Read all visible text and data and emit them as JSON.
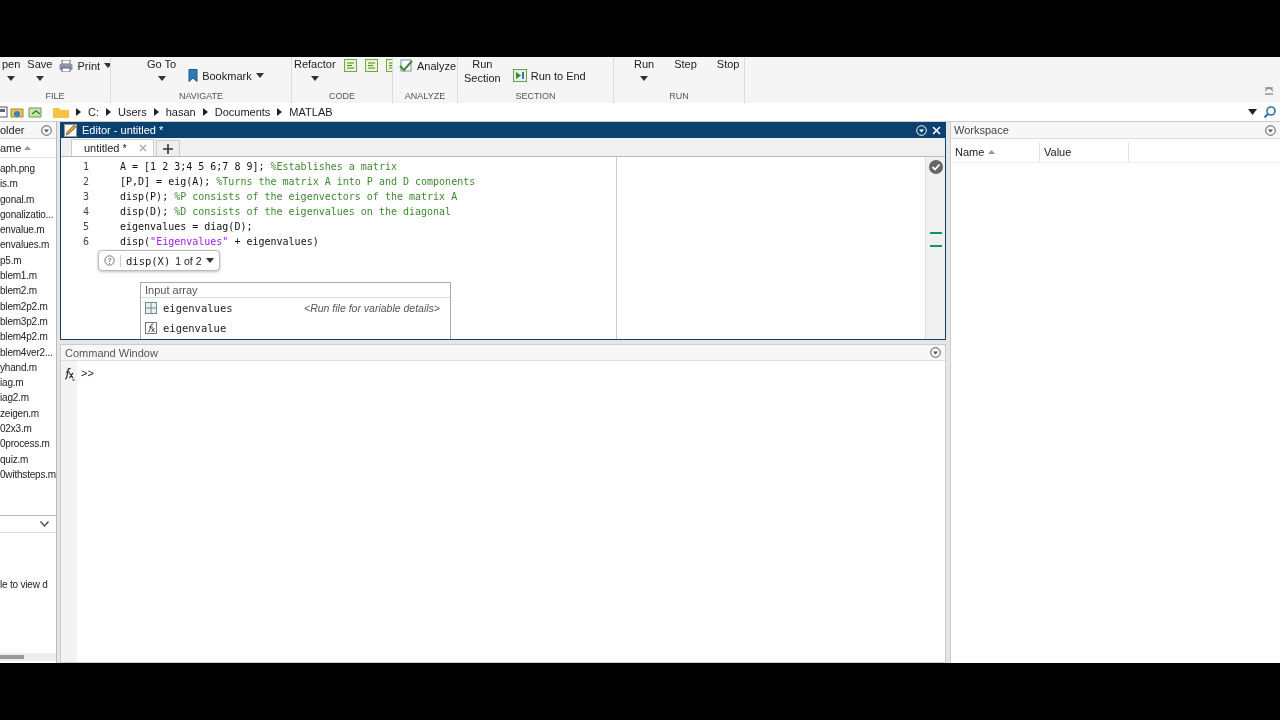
{
  "toolstrip": {
    "groups": [
      {
        "label": "FILE",
        "columns": [
          {
            "kind": "big",
            "label": "pen",
            "caret": true
          },
          {
            "kind": "big",
            "label": "Save",
            "caret": true
          },
          {
            "kind": "small",
            "items": [
              {
                "label": "Print",
                "caret": true
              }
            ]
          }
        ]
      },
      {
        "label": "NAVIGATE",
        "columns": [
          {
            "kind": "big",
            "label": "Go To",
            "caret": true
          },
          {
            "kind": "small",
            "items": [
              {
                "label": "Bookmark",
                "caret": true
              }
            ]
          }
        ]
      },
      {
        "label": "CODE",
        "columns": [
          {
            "kind": "big",
            "label": "Refactor",
            "caret": true
          },
          {
            "kind": "icons",
            "items": [
              {
                "kind": "icon"
              },
              {
                "kind": "icon"
              },
              {
                "kind": "icon"
              }
            ]
          }
        ]
      },
      {
        "label": "ANALYZE",
        "columns": [
          {
            "kind": "small",
            "items": [
              {
                "label": "Analyze"
              }
            ]
          }
        ]
      },
      {
        "label": "SECTION",
        "columns": [
          {
            "kind": "big",
            "label": "Run\nSection",
            "caret": false
          },
          {
            "kind": "small",
            "items": [
              {
                "label": "Run to End"
              }
            ]
          }
        ]
      },
      {
        "label": "RUN",
        "columns": [
          {
            "kind": "big",
            "label": "Run",
            "caret": true
          },
          {
            "kind": "big",
            "label": "Step",
            "caret": false
          },
          {
            "kind": "big",
            "label": "Stop",
            "caret": false
          }
        ]
      }
    ]
  },
  "address_bar": {
    "path": [
      "C:",
      "Users",
      "hasan",
      "Documents",
      "MATLAB"
    ]
  },
  "current_folder": {
    "title": "older",
    "column": "ame",
    "files": [
      "aph.png",
      "is.m",
      "gonal.m",
      "gonalizatio...",
      "envalue.m",
      "envalues.m",
      "p5.m",
      "blem1.m",
      "blem2.m",
      "blem2p2.m",
      "blem3p2.m",
      "blem4p2.m",
      "blem4ver2...",
      "yhand.m",
      "iag.m",
      "iag2.m",
      "zeigen.m",
      "02x3.m",
      "0process.m",
      "quiz.m",
      "0withsteps.m"
    ],
    "details_text": "le to view d"
  },
  "editor": {
    "title": "Editor - untitled *",
    "tabs": [
      {
        "label": "untitled *",
        "selected": true
      }
    ],
    "lines": [
      {
        "number": "1",
        "segments": [
          {
            "kind": "code",
            "text": "A = [1 2 3;4 5 6;7 8 9]; "
          },
          {
            "kind": "comment",
            "text": "%Establishes a matrix"
          }
        ]
      },
      {
        "number": "2",
        "segments": [
          {
            "kind": "code",
            "text": "[P,D] = eig(A); "
          },
          {
            "kind": "comment",
            "text": "%Turns the matrix A into P and D components"
          }
        ]
      },
      {
        "number": "3",
        "segments": [
          {
            "kind": "code",
            "text": "disp(P); "
          },
          {
            "kind": "comment",
            "text": "%P consists of the eigenvectors of the matrix A"
          }
        ]
      },
      {
        "number": "4",
        "segments": [
          {
            "kind": "code",
            "text": "disp(D); "
          },
          {
            "kind": "comment",
            "text": "%D consists of the eigenvalues on the diagonal"
          }
        ]
      },
      {
        "number": "5",
        "segments": [
          {
            "kind": "code",
            "text": "eigenvalues = diag(D);"
          }
        ]
      },
      {
        "number": "6",
        "segments": [
          {
            "kind": "code",
            "text": "disp("
          },
          {
            "kind": "string",
            "text": "\"Eigenvalues\""
          },
          {
            "kind": "code",
            "text": " + eigenvalues)"
          }
        ]
      }
    ],
    "signature_hint": {
      "signature": "disp(X)",
      "overload": "1 of 2"
    },
    "completion": {
      "header": "Input array",
      "items": [
        {
          "kind": "variable",
          "label": "eigenvalues",
          "detail": "<Run file for variable details>"
        },
        {
          "kind": "function",
          "label": "eigenvalue"
        }
      ]
    }
  },
  "command_window": {
    "title": "Command Window",
    "prompt": ">>"
  },
  "workspace": {
    "title": "Workspace",
    "columns": [
      "Name",
      "Value"
    ]
  }
}
